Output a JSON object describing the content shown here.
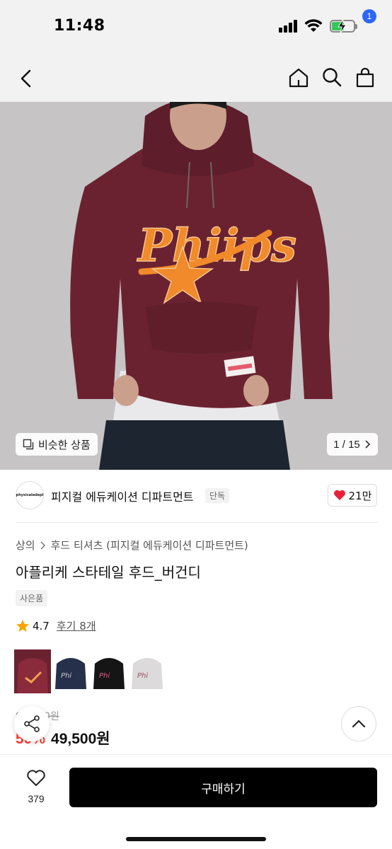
{
  "status_bar": {
    "time": "11:48"
  },
  "nav": {
    "cart_count": "1"
  },
  "hero": {
    "similar_label": "비슷한 상품",
    "counter": "1 / 15",
    "graphic_text": "Phiips"
  },
  "brand": {
    "logo_text": "physicaledepl",
    "name": "피지컬 에듀케이션 디파트먼트",
    "tag": "단독",
    "likes": "21만"
  },
  "product": {
    "breadcrumb": [
      "상의",
      "후드 티셔츠 (피지컬 에듀케이션 디파트먼트)"
    ],
    "title": "아플리케 스타테일 후드_버건디",
    "gift_tag": "사은품",
    "rating": "4.7",
    "reviews": "후기 8개",
    "color_options": [
      "버건디",
      "네이비",
      "블랙",
      "그레이"
    ],
    "original_price": "99,000원",
    "discount": "50%",
    "price": "49,500원"
  },
  "bottom": {
    "wish_count": "379",
    "buy_label": "구매하기"
  },
  "colors": {
    "accent_blue": "#2e66f6",
    "heart_red": "#e8213a",
    "discount_red": "#ff3b30",
    "hoodie_burgundy": "#6b2230"
  }
}
